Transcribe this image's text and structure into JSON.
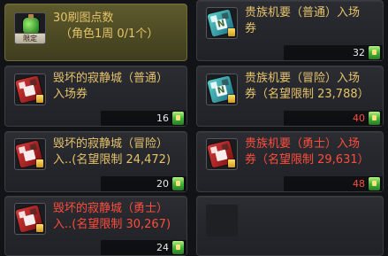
{
  "items": [
    {
      "title_line1": "30刷图点数",
      "title_line2": "（角色1周 0/1个）",
      "title_color": "#e6c36a",
      "icon": "green-potion-icon",
      "badge": "限定",
      "count": "",
      "selected": true
    },
    {
      "title_line1": "贵族机要（普通）入场",
      "title_line2": "券",
      "title_color": "#e6c36a",
      "icon": "teal-ticket-icon",
      "count": "32",
      "count_color": "#e8e8e8"
    },
    {
      "title_line1": "毁坏的寂静城（普通）",
      "title_line2": "入场券",
      "title_color": "#e6c36a",
      "icon": "red-ticket-icon",
      "count": "16",
      "count_color": "#e8e8e8"
    },
    {
      "title_line1": "贵族机要（冒险）入场",
      "title_line2": "券（名望限制 23,788）",
      "title_color": "#e6c36a",
      "icon": "teal-ticket-icon",
      "count": "40",
      "count_color": "#ff4c3c"
    },
    {
      "title_line1": "毁坏的寂静城（冒险）",
      "title_line2": "入..(名望限制 24,472)",
      "title_color": "#e6c36a",
      "icon": "red-ticket-icon",
      "count": "20",
      "count_color": "#e8e8e8"
    },
    {
      "title_line1": "贵族机要（勇士）入场",
      "title_line2": "券（名望限制 29,631）",
      "title_color": "#ff4c3c",
      "icon": "red-ticket-icon",
      "count": "48",
      "count_color": "#ff4c3c"
    },
    {
      "title_line1": "毁坏的寂静城（勇士）",
      "title_line2": "入..(名望限制 30,267)",
      "title_color": "#ff4c3c",
      "icon": "red-ticket-icon",
      "count": "24",
      "count_color": "#e8e8e8"
    }
  ]
}
